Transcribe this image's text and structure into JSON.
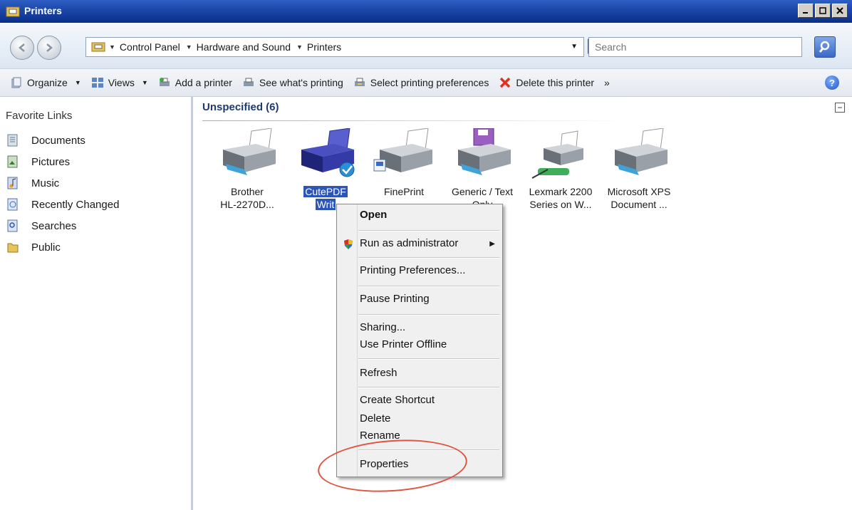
{
  "window": {
    "title": "Printers"
  },
  "address": {
    "crumbs": [
      "Control Panel",
      "Hardware and Sound",
      "Printers"
    ],
    "search_placeholder": "Search"
  },
  "toolbar": {
    "organize": "Organize",
    "views": "Views",
    "add_printer": "Add a printer",
    "see_printing": "See what's printing",
    "select_prefs": "Select printing preferences",
    "delete_printer": "Delete this printer",
    "more": "»"
  },
  "sidebar": {
    "header": "Favorite Links",
    "items": [
      {
        "label": "Documents"
      },
      {
        "label": "Pictures"
      },
      {
        "label": "Music"
      },
      {
        "label": "Recently Changed"
      },
      {
        "label": "Searches"
      },
      {
        "label": "Public"
      }
    ]
  },
  "group": {
    "header": "Unspecified (6)"
  },
  "printers": [
    {
      "line1": "Brother",
      "line2": "HL-2270D..."
    },
    {
      "line1": "CutePDF",
      "line2": "Writ"
    },
    {
      "line1": "FinePrint",
      "line2": ""
    },
    {
      "line1": "Generic / Text",
      "line2": "Only"
    },
    {
      "line1": "Lexmark 2200",
      "line2": "Series on W..."
    },
    {
      "line1": "Microsoft XPS",
      "line2": "Document ..."
    }
  ],
  "context_menu": {
    "open": "Open",
    "run_as_admin": "Run as administrator",
    "printing_prefs": "Printing Preferences...",
    "pause": "Pause Printing",
    "sharing": "Sharing...",
    "offline": "Use Printer Offline",
    "refresh": "Refresh",
    "create_shortcut": "Create Shortcut",
    "delete": "Delete",
    "rename": "Rename",
    "properties": "Properties"
  },
  "colors": {
    "title_bar": "#1b46a8",
    "selection": "#2d55b8",
    "annotation": "#e0533f"
  }
}
